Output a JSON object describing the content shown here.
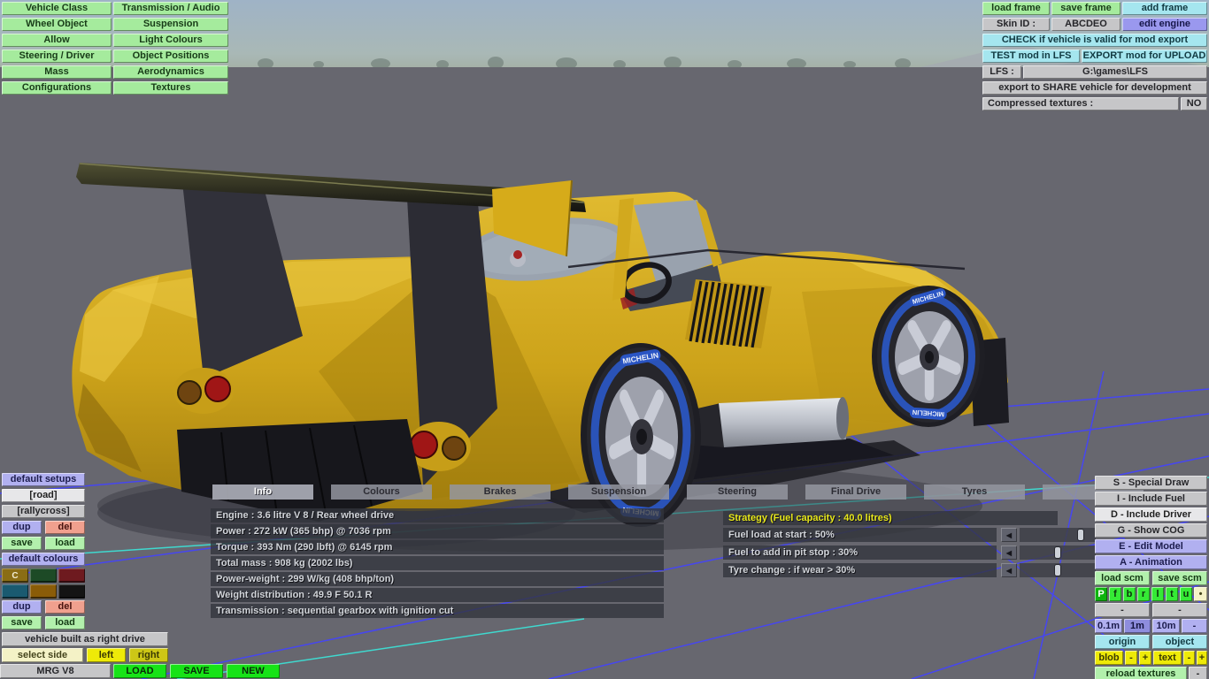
{
  "menu": {
    "left": [
      "Vehicle Class",
      "Wheel Object",
      "Allow",
      "Steering / Driver",
      "Mass",
      "Configurations"
    ],
    "right": [
      "Transmission / Audio",
      "Suspension",
      "Light Colours",
      "Object Positions",
      "Aerodynamics",
      "Textures"
    ]
  },
  "frames": {
    "load": "load frame",
    "save": "save frame",
    "add": "add frame"
  },
  "skin": {
    "label": "Skin ID :",
    "value": "ABCDEO",
    "edit_engine": "edit engine"
  },
  "export": {
    "check": "CHECK if vehicle is valid for mod export",
    "test": "TEST mod in LFS",
    "upload": "EXPORT mod for UPLOAD",
    "lfs_label": "LFS :",
    "lfs_path": "G:\\games\\LFS",
    "share": "export to SHARE vehicle for development",
    "compressed_label": "Compressed textures :",
    "compressed_value": "NO"
  },
  "common": {
    "dup": "dup",
    "del": "del",
    "save": "save",
    "load": "load"
  },
  "setups": {
    "title": "default setups",
    "presets": [
      "[road]",
      "[rallycross]"
    ]
  },
  "colours": {
    "title": "default colours",
    "letter": "C",
    "swatches": [
      [
        "#8a6d15",
        "#1d4a26",
        "#6e1a1f"
      ],
      [
        "#1a5a70",
        "#8a5c08",
        "#141414"
      ]
    ]
  },
  "drive": {
    "built": "vehicle built as right drive",
    "select_side": "select side",
    "left": "left",
    "right": "right"
  },
  "file": {
    "name": "MRG V8",
    "load": "LOAD",
    "save": "SAVE",
    "new": "NEW"
  },
  "tabs": [
    "Info",
    "Colours",
    "Brakes",
    "Suspension",
    "Steering",
    "Final Drive",
    "Tyres",
    ""
  ],
  "info_panel": {
    "rows": [
      "Engine : 3.6 litre V 8 / Rear wheel drive",
      "Power : 272 kW (365 bhp) @ 7036 rpm",
      "Torque : 393 Nm (290 lbft) @ 6145 rpm",
      "Total mass : 908 kg (2002 lbs)",
      "Power-weight : 299 W/kg (408 bhp/ton)",
      "Weight distribution : 49.9 F  50.1 R",
      "Transmission : sequential gearbox with ignition cut"
    ]
  },
  "strategy": {
    "header": "Strategy (Fuel capacity : 40.0 litres)",
    "arrow": "◀",
    "rows": [
      "Fuel load at start : 50%",
      "Fuel to add in pit stop : 30%",
      "Tyre change : if wear > 30%"
    ]
  },
  "right_panel": {
    "items": [
      "S - Special Draw",
      "I - Include Fuel",
      "D - Include Driver",
      "G - Show COG",
      "E - Edit Model",
      "A - Animation"
    ],
    "load_scm": "load scm",
    "save_scm": "save scm",
    "letters": [
      "P",
      "f",
      "b",
      "r",
      "l",
      "t",
      "u",
      "•"
    ],
    "tilde": "-",
    "scales": [
      "0.1m",
      "1m",
      "10m",
      "-"
    ],
    "origin": "origin",
    "object": "object",
    "blob": "blob",
    "text": "text",
    "minus": "-",
    "plus": "+",
    "reload": "reload textures",
    "reload_minus": "-"
  },
  "scene": {
    "tyre_brand": "MICHELIN",
    "body_colour": "#d2a81e",
    "grid_blue": "#4646f2",
    "grid_cyan": "#3fd9cf"
  }
}
